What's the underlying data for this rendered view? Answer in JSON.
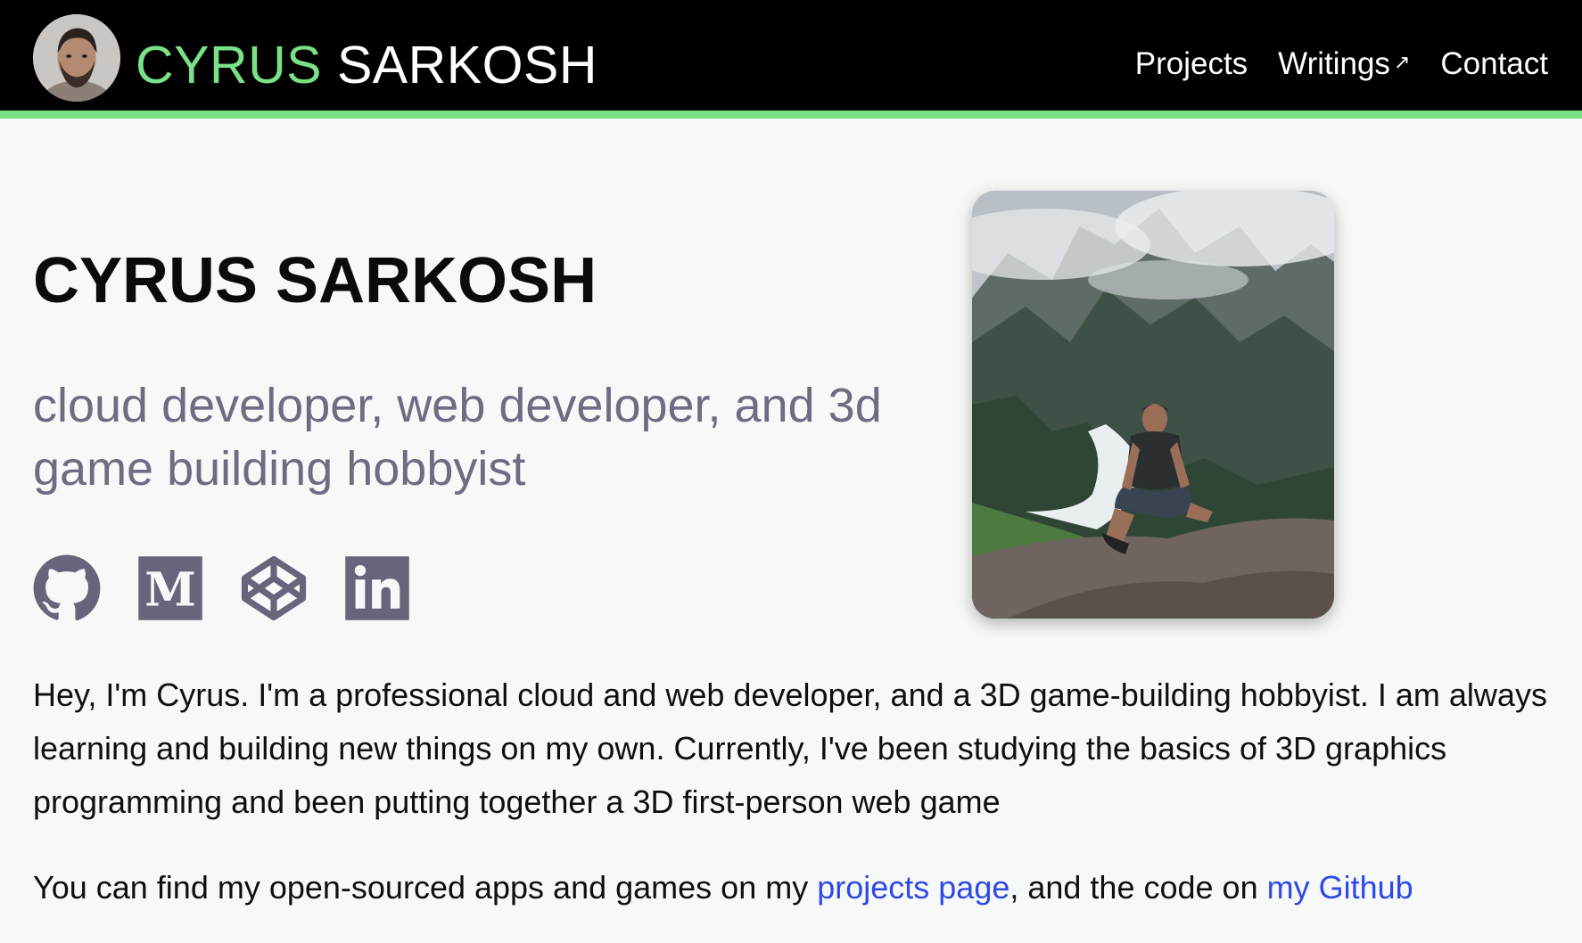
{
  "header": {
    "brand_first": "CYRUS",
    "brand_last": "SARKOSH",
    "avatar_alt": "Cyrus Sarkosh avatar",
    "nav": [
      {
        "label": "Projects"
      },
      {
        "label": "Writings",
        "external_icon": "external-link-icon"
      },
      {
        "label": "Contact"
      }
    ]
  },
  "hero": {
    "title": "CYRUS SARKOSH",
    "tagline": "cloud developer, web developer, and 3d game building hobbyist",
    "photo_alt": "Photo of Cyrus sitting on a rock in the mountains"
  },
  "socials": [
    {
      "name": "github",
      "icon": "github-icon"
    },
    {
      "name": "medium",
      "icon": "medium-icon"
    },
    {
      "name": "codepen",
      "icon": "codepen-icon"
    },
    {
      "name": "linkedin",
      "icon": "linkedin-icon"
    }
  ],
  "about": {
    "bio": "Hey, I'm Cyrus. I'm a professional cloud and web developer, and a 3D game-building hobbyist. I am always learning and building new things on my own. Currently, I've been studying the basics of 3D graphics programming and been putting together a 3D first-person web game",
    "links_prefix": "You can find my open-sourced apps and games on my ",
    "projects_link": "projects page",
    "links_middle": ", and the code on ",
    "github_link": "my Github"
  },
  "colors": {
    "accent_green": "#79e186",
    "link_blue": "#2f49e7",
    "muted_text": "#6e6c82",
    "header_bg": "#000000",
    "page_bg": "#f7f9f8"
  }
}
